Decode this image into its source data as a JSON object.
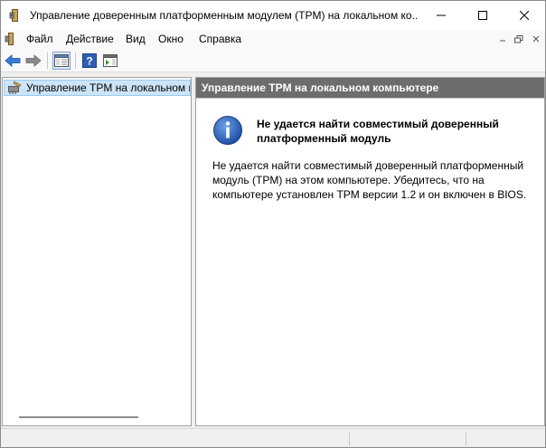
{
  "window": {
    "title": "Управление доверенным платформенным модулем (TPM) на локальном ко...",
    "controls": {
      "minimize": "minimize-icon",
      "maximize": "maximize-icon",
      "close": "close-icon"
    }
  },
  "menu": {
    "items": [
      {
        "label": "Файл"
      },
      {
        "label": "Действие"
      },
      {
        "label": "Вид"
      },
      {
        "label": "Окно"
      },
      {
        "label": "Справка"
      }
    ]
  },
  "toolbar": {
    "buttons": [
      "back-arrow-icon",
      "forward-arrow-icon",
      "show-hide-console-tree-icon",
      "help-icon",
      "show-hide-action-pane-icon"
    ]
  },
  "tree": {
    "items": [
      {
        "label": "Управление TPM на локальном к",
        "icon": "tpm-chip-icon"
      }
    ]
  },
  "content": {
    "header": "Управление TPM на локальном компьютере",
    "message": {
      "icon": "info-icon",
      "title": "Не удается найти совместимый доверенный платформенный модуль",
      "body": "Не удается найти совместимый доверенный платформенный модуль (TPM) на этом компьютере. Убедитесь, что на компьютере установлен TPM версии 1.2 и он включен в BIOS."
    }
  },
  "colors": {
    "header_bg": "#6d6d6d",
    "selection_bg": "#cce4f7",
    "info_blue": "#2b5fb3"
  }
}
